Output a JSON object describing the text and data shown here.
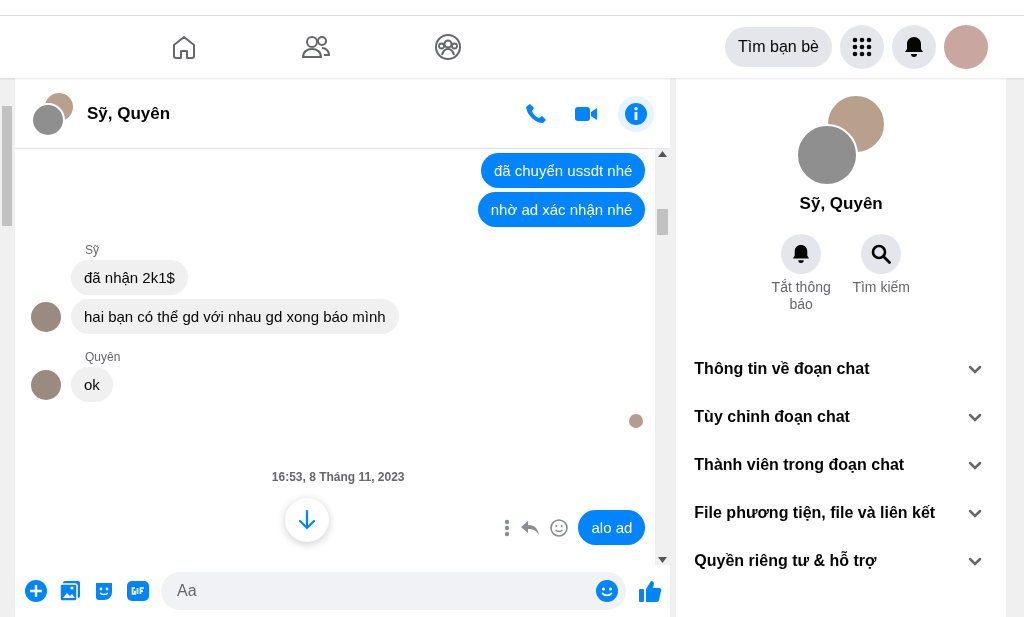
{
  "nav": {
    "find_friends": "Tìm bạn bè"
  },
  "chat": {
    "title": "Sỹ, Quyên",
    "messages": [
      {
        "kind": "outgoing",
        "text": "đã chuyển ussdt nhé"
      },
      {
        "kind": "outgoing",
        "text": "nhờ ad xác nhận nhé"
      },
      {
        "kind": "sender",
        "text": "Sỹ"
      },
      {
        "kind": "incoming",
        "text": "đã nhận 2k1$",
        "avatar": false
      },
      {
        "kind": "incoming",
        "text": "hai bạn có thể gd với nhau gd xong báo mình",
        "avatar": true
      },
      {
        "kind": "sender",
        "text": "Quyên"
      },
      {
        "kind": "incoming",
        "text": "ok",
        "avatar": true
      },
      {
        "kind": "seen"
      },
      {
        "kind": "timestamp",
        "text": "16:53, 8 Tháng 11, 2023"
      },
      {
        "kind": "outgoing_actions",
        "text": "alo ad"
      }
    ],
    "composer": {
      "placeholder": "Aa"
    }
  },
  "info": {
    "title": "Sỹ, Quyên",
    "actions": [
      {
        "kind": "mute",
        "label": "Tắt thông báo"
      },
      {
        "kind": "search",
        "label": "Tìm kiếm"
      }
    ],
    "sections": [
      {
        "label": "Thông tin về đoạn chat",
        "expanded": false
      },
      {
        "label": "Tùy chỉnh đoạn chat",
        "expanded": false
      },
      {
        "label": "Thành viên trong đoạn chat",
        "expanded": false
      },
      {
        "label": "File phương tiện, file và liên kết",
        "expanded": false
      },
      {
        "label": "Quyền riêng tư & hỗ trợ",
        "expanded": false
      }
    ]
  }
}
